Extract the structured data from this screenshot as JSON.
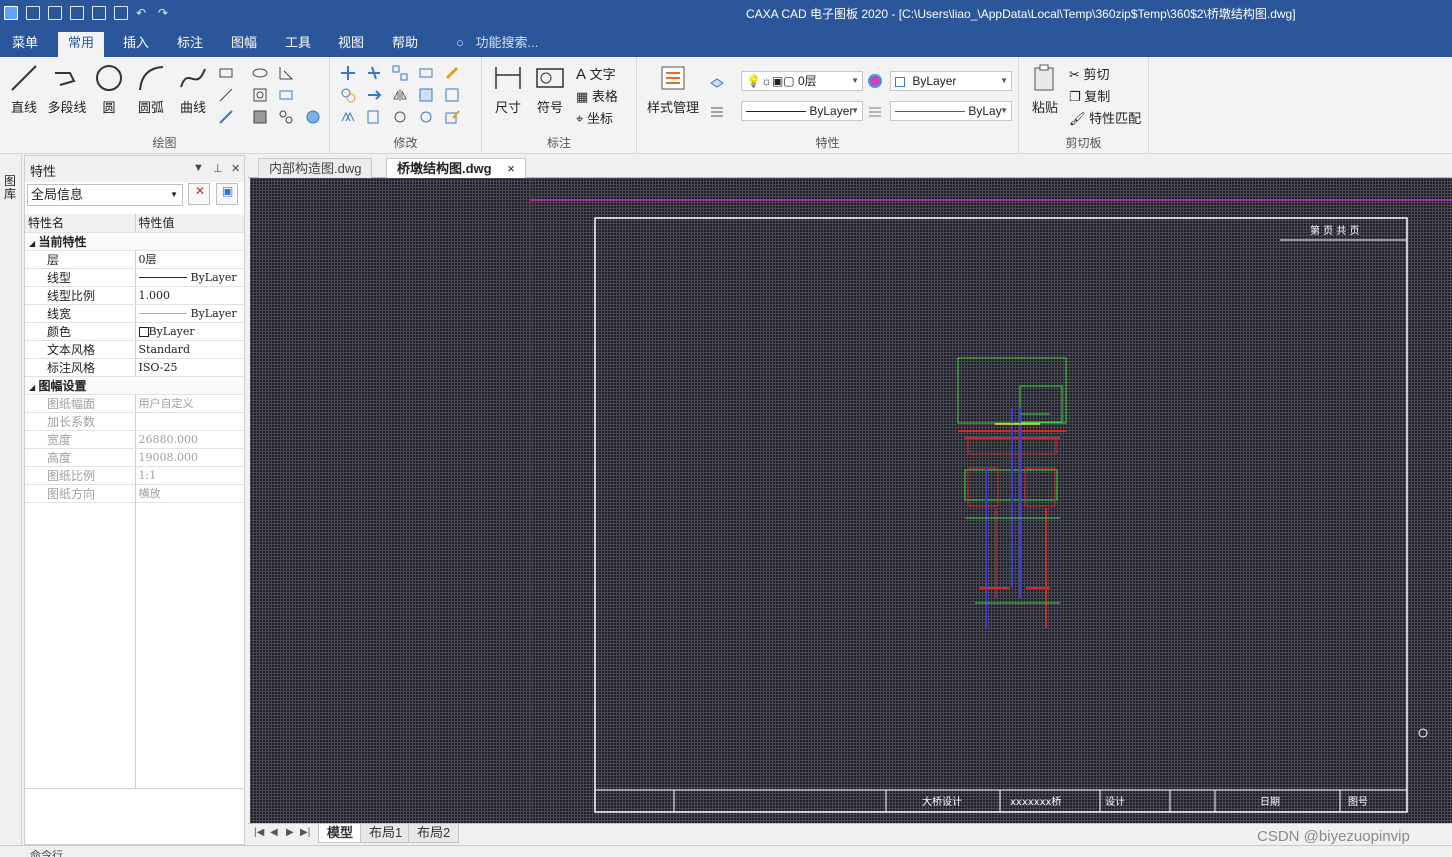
{
  "window": {
    "title": "CAXA CAD 电子图板 2020 - [C:\\Users\\liao_\\AppData\\Local\\Temp\\360zip$Temp\\360$2\\桥墩结构图.dwg]"
  },
  "ribbon_tabs": [
    "菜单",
    "常用",
    "插入",
    "标注",
    "图幅",
    "工具",
    "视图",
    "帮助"
  ],
  "active_ribbon_tab": "常用",
  "search_placeholder": "功能搜索...",
  "groups": {
    "draw": {
      "label": "绘图",
      "buttons": [
        "直线",
        "多段线",
        "圆",
        "圆弧",
        "曲线"
      ]
    },
    "modify": {
      "label": "修改"
    },
    "annotate": {
      "label": "标注",
      "buttons": [
        "尺寸",
        "符号"
      ],
      "small": [
        "文字",
        "表格",
        "坐标"
      ]
    },
    "properties": {
      "label": "特性",
      "style_manager": "样式管理",
      "layer": "0层",
      "color": "ByLayer",
      "linetype": "ByLayer",
      "lineweight": "ByLay"
    },
    "clipboard": {
      "label": "剪切板",
      "paste": "粘贴",
      "items": [
        "剪切",
        "复制",
        "特性匹配"
      ]
    }
  },
  "side_strip": {
    "label": "图库"
  },
  "properties_panel": {
    "title": "特性",
    "selector": "全局信息",
    "columns": [
      "特性名",
      "特性值"
    ],
    "sections": [
      {
        "title": "当前特性",
        "rows": [
          {
            "name": "层",
            "value": "0层"
          },
          {
            "name": "线型",
            "value": "ByLayer"
          },
          {
            "name": "线型比例",
            "value": "1.000"
          },
          {
            "name": "线宽",
            "value": "ByLayer"
          },
          {
            "name": "颜色",
            "value": "ByLayer"
          },
          {
            "name": "文本风格",
            "value": "Standard"
          },
          {
            "name": "标注风格",
            "value": "ISO-25"
          }
        ]
      },
      {
        "title": "图幅设置",
        "rows": [
          {
            "name": "图纸幅面",
            "value": "用户自定义"
          },
          {
            "name": "加长系数",
            "value": ""
          },
          {
            "name": "宽度",
            "value": "26880.000"
          },
          {
            "name": "高度",
            "value": "19008.000"
          },
          {
            "name": "图纸比例",
            "value": "1:1"
          },
          {
            "name": "图纸方向",
            "value": "横放"
          }
        ]
      }
    ]
  },
  "doc_tabs": [
    {
      "label": "内部构造图.dwg",
      "active": false
    },
    {
      "label": "桥墩结构图.dwg",
      "active": true
    }
  ],
  "doc_tab_close": "×",
  "layout_tabs": [
    {
      "label": "模型",
      "active": true
    },
    {
      "label": "布局1",
      "active": false
    },
    {
      "label": "布局2",
      "active": false
    }
  ],
  "title_block": {
    "designer_cell": "大桥设计",
    "code_cell": "xxxxxxx桥",
    "design_label": "设计",
    "date_label": "日期",
    "figure_no": "图号",
    "header_right": "第  页  共  页"
  },
  "command_prompt": "命令行",
  "watermark": "CSDN @biyezuopinvip",
  "colors": {
    "title_bar": "#2b579a",
    "canvas_bg": "#202020",
    "drawing_green": "#3cd23c",
    "drawing_red": "#d22828",
    "drawing_blue": "#3c3cdc",
    "frame_line": "#ffffff",
    "top_magenta": "#c030c0"
  }
}
